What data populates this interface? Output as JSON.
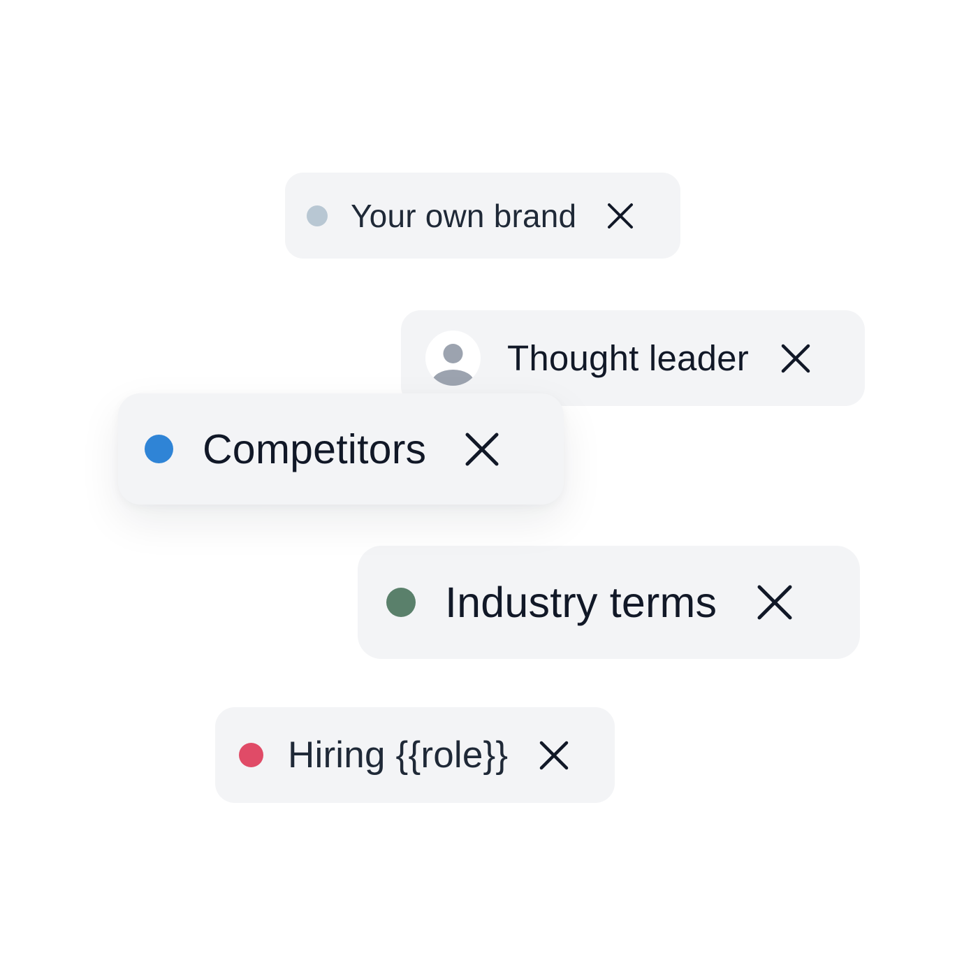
{
  "chips": [
    {
      "label": "Your own brand",
      "indicator": "dot",
      "color": "#b8c7d3",
      "close_icon": "close-icon"
    },
    {
      "label": "Thought leader",
      "indicator": "avatar",
      "avatar_icon": "person-icon",
      "close_icon": "close-icon"
    },
    {
      "label": "Competitors",
      "indicator": "dot",
      "color": "#2f84d6",
      "close_icon": "close-icon"
    },
    {
      "label": "Industry terms",
      "indicator": "dot",
      "color": "#5a806b",
      "close_icon": "close-icon"
    },
    {
      "label": "Hiring {{role}}",
      "indicator": "dot",
      "color": "#e04b67",
      "close_icon": "close-icon"
    }
  ]
}
